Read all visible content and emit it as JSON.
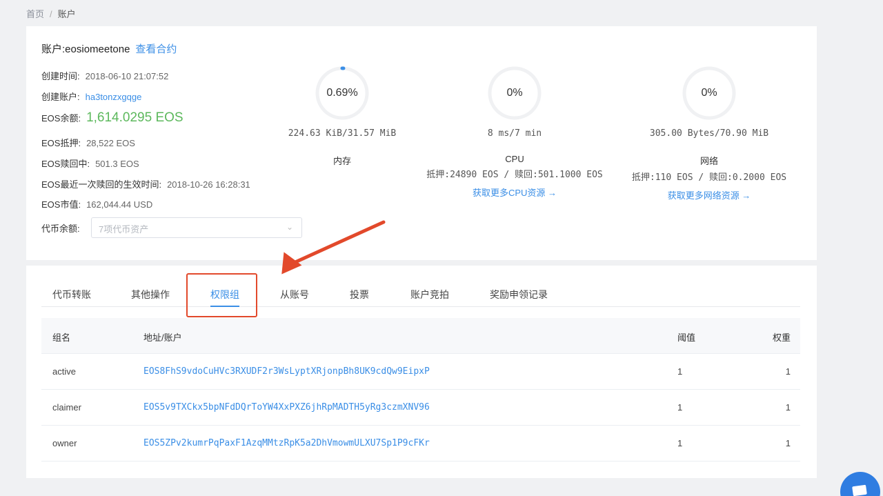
{
  "breadcrumb": {
    "home": "首页",
    "sep": "/",
    "current": "账户"
  },
  "account": {
    "label": "账户:",
    "name": "eosiomeetone",
    "view_contract": "查看合约"
  },
  "info": {
    "created_time_label": "创建时间:",
    "created_time": "2018-06-10 21:07:52",
    "creator_label": "创建账户:",
    "creator": "ha3tonzxgqge",
    "balance_label": "EOS余额:",
    "balance": "1,614.0295 EOS",
    "staked_label": "EOS抵押:",
    "staked": "28,522 EOS",
    "refunding_label": "EOS赎回中:",
    "refunding": "501.3 EOS",
    "refund_time_label": "EOS最近一次赎回的生效时间:",
    "refund_time": "2018-10-26 16:28:31",
    "market_value_label": "EOS市值:",
    "market_value": "162,044.44 USD",
    "token_label": "代币余额:",
    "token_placeholder": "7项代币资产"
  },
  "resources": {
    "ram": {
      "percent": "0.69%",
      "fraction": 0.0069,
      "usage": "224.63 KiB/31.57 MiB",
      "name": "内存"
    },
    "cpu": {
      "percent": "0%",
      "fraction": 0,
      "usage": "8 ms/7 min",
      "name": "CPU",
      "stake": "抵押:24890 EOS / 赎回:501.1000 EOS",
      "more": "获取更多CPU资源 →"
    },
    "net": {
      "percent": "0%",
      "fraction": 0,
      "usage": "305.00 Bytes/70.90 MiB",
      "name": "网络",
      "stake": "抵押:110 EOS / 赎回:0.2000 EOS",
      "more": "获取更多网络资源 →"
    }
  },
  "tabs": [
    "代币转账",
    "其他操作",
    "权限组",
    "从账号",
    "投票",
    "账户竞拍",
    "奖励申领记录"
  ],
  "active_tab": "权限组",
  "table": {
    "headers": [
      "组名",
      "地址/账户",
      "阈值",
      "权重"
    ],
    "rows": [
      {
        "group": "active",
        "key": "EOS8FhS9vdoCuHVc3RXUDF2r3WsLyptXRjonpBh8UK9cdQw9EipxP",
        "threshold": "1",
        "weight": "1"
      },
      {
        "group": "claimer",
        "key": "EOS5v9TXCkx5bpNFdDQrToYW4XxPXZ6jhRpMADTH5yRg3czmXNV96",
        "threshold": "1",
        "weight": "1"
      },
      {
        "group": "owner",
        "key": "EOS5ZPv2kumrPqPaxF1AzqMMtzRpK5a2DhVmowmULXU7Sp1P9cFKr",
        "threshold": "1",
        "weight": "1"
      }
    ]
  },
  "colors": {
    "accent": "#3a8ee6",
    "balance": "#5cb85c",
    "annotation": "#e2492b"
  },
  "icons": {
    "select_chevron": "chevron-down-icon",
    "help": "chat-icon"
  }
}
